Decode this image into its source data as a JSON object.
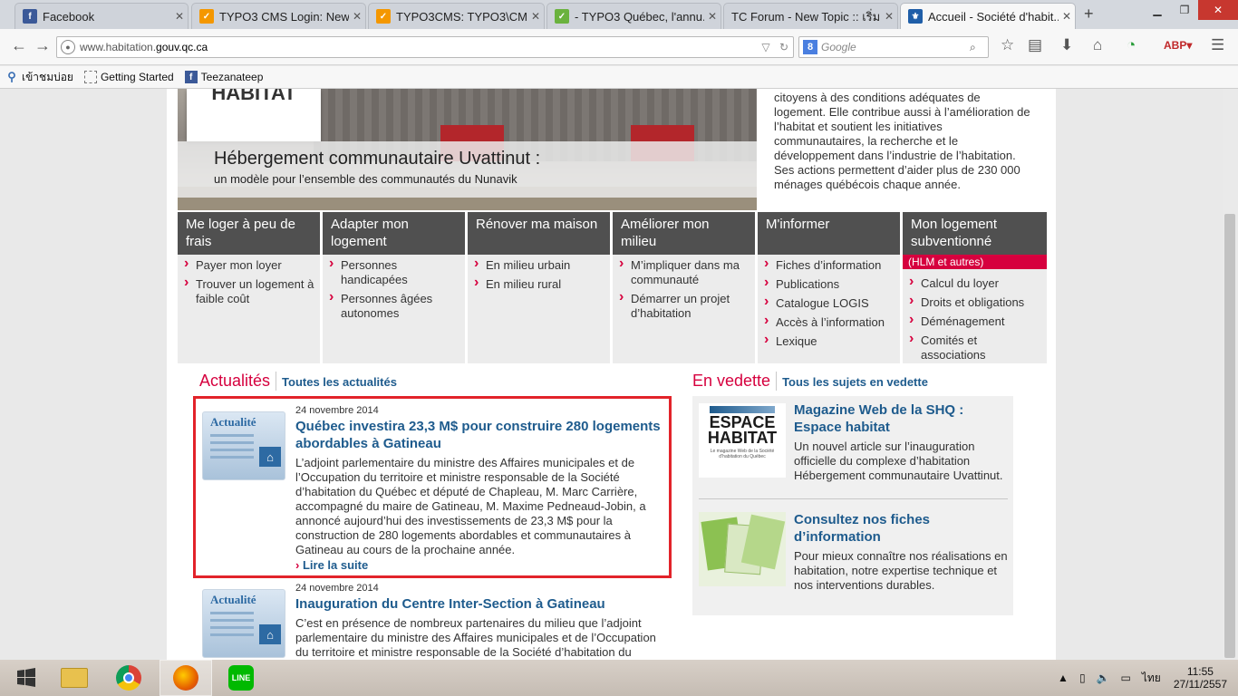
{
  "browser": {
    "tabs": [
      {
        "title": "Facebook",
        "icon": "facebook-icon",
        "active": false
      },
      {
        "title": "TYPO3 CMS Login: New...",
        "icon": "typo3-icon",
        "active": false
      },
      {
        "title": "TYPO3CMS: TYPO3\\CM...",
        "icon": "typo3-icon",
        "active": false
      },
      {
        "title": "- TYPO3 Québec, l'annu...",
        "icon": "typo3-quebec-icon",
        "active": false
      },
      {
        "title": "TC Forum - New Topic :: เริ่ม...",
        "icon": "",
        "active": false
      },
      {
        "title": "Accueil - Société d'habit...",
        "icon": "quebec-flag-icon",
        "active": true
      }
    ],
    "url_prefix": "www.habitation.",
    "url_domain": "gouv.qc.ca",
    "search_placeholder": "Google",
    "bookmarks": [
      {
        "label": "เข้าชมบ่อย",
        "icon": "most-visited-icon"
      },
      {
        "label": "Getting Started",
        "icon": "page-icon"
      },
      {
        "label": "Teezanateep",
        "icon": "facebook-icon"
      }
    ]
  },
  "hero": {
    "logo_text": "HABITAT",
    "caption_title": "Hébergement communautaire Uvattinut :",
    "caption_sub": "un modèle pour l’ensemble des communautés du Nunavik"
  },
  "intro": {
    "text": "citoyens à des conditions adéquates de logement. Elle contribue aussi à l’amélioration de l’habitat et soutient les initiatives communautaires, la recherche et le développement dans l’industrie de l’habitation. Ses actions permettent d’aider plus de 230 000 ménages québécois chaque année."
  },
  "nav_columns": [
    {
      "title": "Me loger à peu de frais",
      "subtitle": "",
      "items": [
        "Payer mon loyer",
        "Trouver un logement à faible coût"
      ]
    },
    {
      "title": "Adapter mon logement",
      "subtitle": "",
      "items": [
        "Personnes handicapées",
        "Personnes âgées autonomes"
      ]
    },
    {
      "title": "Rénover ma maison",
      "subtitle": "",
      "items": [
        "En milieu urbain",
        "En milieu rural"
      ]
    },
    {
      "title": "Améliorer mon milieu",
      "subtitle": "",
      "items": [
        "M’impliquer dans ma communauté",
        "Démarrer un projet d’habitation"
      ]
    },
    {
      "title": "M'informer",
      "subtitle": "",
      "items": [
        "Fiches d’information",
        "Publications",
        "Catalogue LOGIS",
        "Accès à l’information",
        "Lexique"
      ]
    },
    {
      "title": "Mon logement subventionné",
      "subtitle": "(HLM et autres)",
      "items": [
        "Calcul du loyer",
        "Droits et obligations",
        "Déménagement",
        "Comités et associations"
      ]
    }
  ],
  "news": {
    "heading": "Actualités",
    "all_link": "Toutes les actualités",
    "thumb_label": "Actualité",
    "items": [
      {
        "date": "24 novembre 2014",
        "title": "Québec investira 23,3 M$ pour construire 280 logements abordables à Gatineau",
        "text": "L’adjoint parlementaire du ministre des Affaires municipales et de l’Occupation du territoire et ministre responsable de la Société d’habitation du Québec et député de Chapleau, M. Marc Carrière, accompagné du maire de Gatineau, M. Maxime Pedneaud-Jobin, a annoncé aujourd’hui des investissements de 23,3 M$ pour la construction de 280 logements abordables et communautaires à Gatineau au cours de la prochaine année.",
        "more": "Lire la suite"
      },
      {
        "date": "24 novembre 2014",
        "title": "Inauguration du Centre Inter-Section à Gatineau",
        "text": "C’est en présence de nombreux partenaires du milieu que l’adjoint parlementaire du ministre des Affaires municipales et de l’Occupation du territoire et ministre responsable de la Société d’habitation du",
        "more": ""
      }
    ]
  },
  "vedette": {
    "heading": "En vedette",
    "all_link": "Tous les sujets en vedette",
    "items": [
      {
        "title": "Magazine Web de la SHQ : Espace habitat",
        "text": "Un nouvel article sur l’inauguration officielle du complexe d’habitation Hébergement communautaire Uvattinut.",
        "logo_line1": "ESPACE",
        "logo_line2": "HABITAT",
        "logo_small": "Le magazine Web de la Société d’habitation du Québec"
      },
      {
        "title": "Consultez nos fiches d’information",
        "text": "Pour mieux connaître nos réalisations en habitation, notre expertise technique et nos interventions durables."
      }
    ]
  },
  "taskbar": {
    "apps": [
      "start-icon",
      "file-explorer-icon",
      "chrome-icon",
      "firefox-icon",
      "line-icon"
    ],
    "line_label": "LINE",
    "language": "ไทย",
    "time": "11:55",
    "date": "27/11/2557"
  },
  "colors": {
    "accent_red": "#d6003e",
    "link_blue": "#1e5b8d",
    "nav_dark": "#505050",
    "highlight_border": "#e2232a"
  }
}
